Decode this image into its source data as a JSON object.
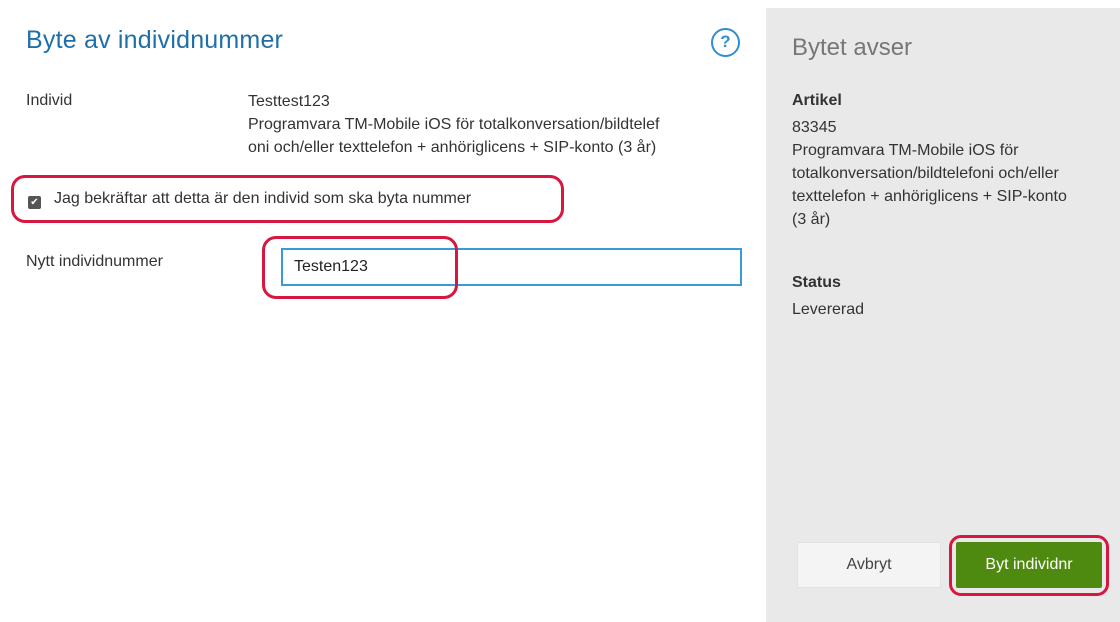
{
  "dialog": {
    "title": "Byte av individnummer",
    "help_icon": "?"
  },
  "individ": {
    "label": "Individ",
    "name": "Testtest123",
    "desc_line1": "Programvara TM-Mobile iOS för totalkonversation/bildtelef",
    "desc_line2": "oni och/eller texttelefon + anhöriglicens + SIP-konto (3 år)"
  },
  "confirm": {
    "checked": true,
    "checkmark": "✔",
    "label": "Jag bekräftar att detta är den individ som ska byta nummer"
  },
  "new_number": {
    "label": "Nytt individnummer",
    "value": "Testen123"
  },
  "side": {
    "title": "Bytet avser",
    "article_heading": "Artikel",
    "article_number": "83345",
    "article_line1": "Programvara TM-Mobile iOS för",
    "article_line2": "totalkonversation/bildtelefoni och/eller",
    "article_line3": "texttelefon + anhöriglicens + SIP-konto",
    "article_line4": "(3 år)",
    "status_heading": "Status",
    "status_value": "Levererad"
  },
  "buttons": {
    "cancel": "Avbryt",
    "submit": "Byt individnr"
  },
  "colors": {
    "accent_blue": "#1f6fa8",
    "highlight_red": "#d7173f",
    "submit_green": "#4f8a10",
    "side_bg": "#e9e9e9"
  }
}
